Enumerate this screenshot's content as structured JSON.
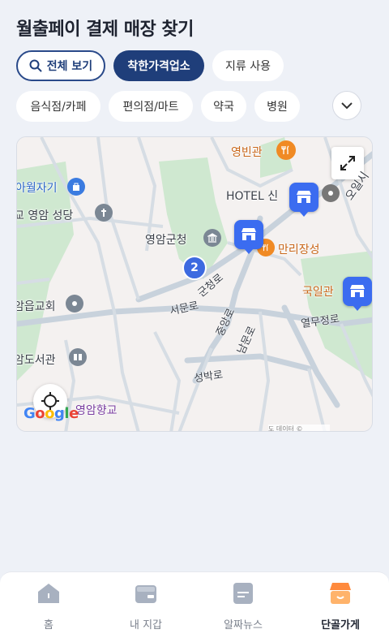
{
  "page": {
    "title": "월출페이 결제 매장 찾기"
  },
  "filters": {
    "view_all": "전체 보기",
    "good_price": "착한가격업소",
    "local": "지류 사용"
  },
  "categories": [
    "음식점/카페",
    "편의점/마트",
    "약국",
    "병원"
  ],
  "map": {
    "labels": {
      "yeongbingwan": "영빈관",
      "hotel": "HOTEL 신",
      "wolja": "아월자기",
      "church": "교 영암 성당",
      "office": "영암군청",
      "manri": "만리장성",
      "gugil": "국일관",
      "eup_church": "암읍교회",
      "library": "암도서관",
      "hyanggyo": "영암향교",
      "oil": "오일시"
    },
    "roads": {
      "gunchung": "군청로",
      "seomun": "서문로",
      "jungang": "중앙로",
      "nammun": "남문로",
      "seongbak": "성박로",
      "yeolmu": "열무정로"
    },
    "cluster_count": "2",
    "google": "Google",
    "attribution": "도 데이터 ©"
  },
  "tabs": [
    {
      "label": "홈",
      "icon": "home-icon"
    },
    {
      "label": "내 지갑",
      "icon": "wallet-icon"
    },
    {
      "label": "알짜뉴스",
      "icon": "news-icon"
    },
    {
      "label": "단골가게",
      "icon": "store-icon"
    }
  ],
  "colors": {
    "accent": "#1f3e7a",
    "marker": "#3b6cf0",
    "poi_orange": "#f08a24",
    "active_tab": "#ff8a3d"
  }
}
